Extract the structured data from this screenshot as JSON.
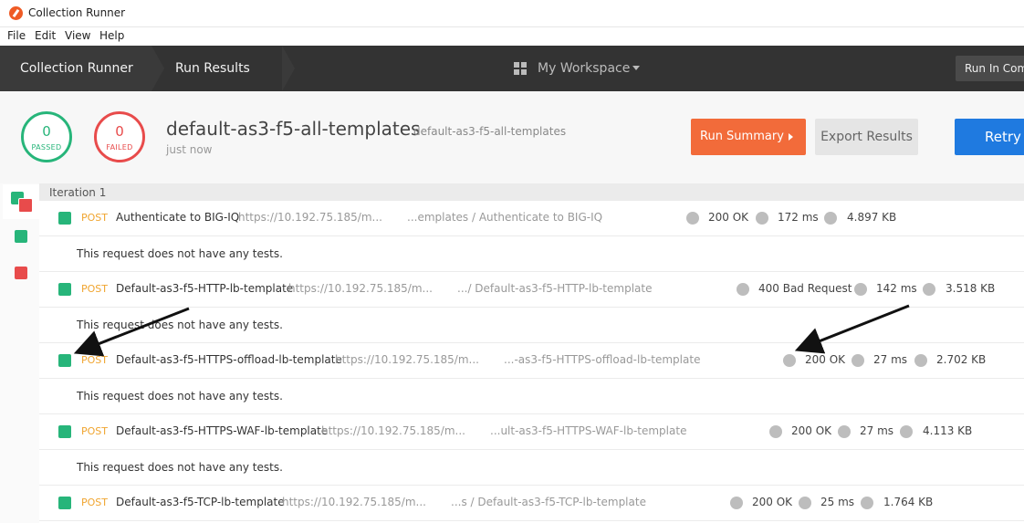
{
  "window": {
    "title": "Collection Runner"
  },
  "menu": [
    "File",
    "Edit",
    "View",
    "Help"
  ],
  "header": {
    "crumb1": "Collection Runner",
    "crumb2": "Run Results",
    "workspace": "My Workspace",
    "run_cmd": "Run In Command Line"
  },
  "summary": {
    "passed_count": "0",
    "passed_label": "PASSED",
    "failed_count": "0",
    "failed_label": "FAILED",
    "run_name": "default-as3-f5-all-templates",
    "run_sub": "default-as3-f5-all-templates",
    "run_time": "just now",
    "run_summary_btn": "Run Summary",
    "export_btn": "Export Results",
    "retry_btn": "Retry"
  },
  "colors": {
    "pass": "#27b57a",
    "fail": "#e84b4b",
    "method": "#f0a530",
    "accent": "#f26b3a"
  },
  "iteration": {
    "label": "Iteration 1"
  },
  "no_tests_text": "This request does not have any tests.",
  "requests": [
    {
      "method": "POST",
      "name": "Authenticate to BIG-IQ",
      "url": "https://10.192.75.185/m...",
      "path": "...emplates / Authenticate to BIG-IQ",
      "status": "200 OK",
      "time": "172 ms",
      "size": "4.897 KB"
    },
    {
      "method": "POST",
      "name": "Default-as3-f5-HTTP-lb-template",
      "url": "https://10.192.75.185/m...",
      "path": ".../ Default-as3-f5-HTTP-lb-template",
      "status": "400 Bad Request",
      "time": "142 ms",
      "size": "3.518 KB"
    },
    {
      "method": "POST",
      "name": "Default-as3-f5-HTTPS-offload-lb-template",
      "url": "https://10.192.75.185/m...",
      "path": "...-as3-f5-HTTPS-offload-lb-template",
      "status": "200 OK",
      "time": "27 ms",
      "size": "2.702 KB"
    },
    {
      "method": "POST",
      "name": "Default-as3-f5-HTTPS-WAF-lb-template",
      "url": "https://10.192.75.185/m...",
      "path": "...ult-as3-f5-HTTPS-WAF-lb-template",
      "status": "200 OK",
      "time": "27 ms",
      "size": "4.113 KB"
    },
    {
      "method": "POST",
      "name": "Default-as3-f5-TCP-lb-template",
      "url": "https://10.192.75.185/m...",
      "path": "...s / Default-as3-f5-TCP-lb-template",
      "status": "200 OK",
      "time": "25 ms",
      "size": "1.764 KB"
    }
  ]
}
